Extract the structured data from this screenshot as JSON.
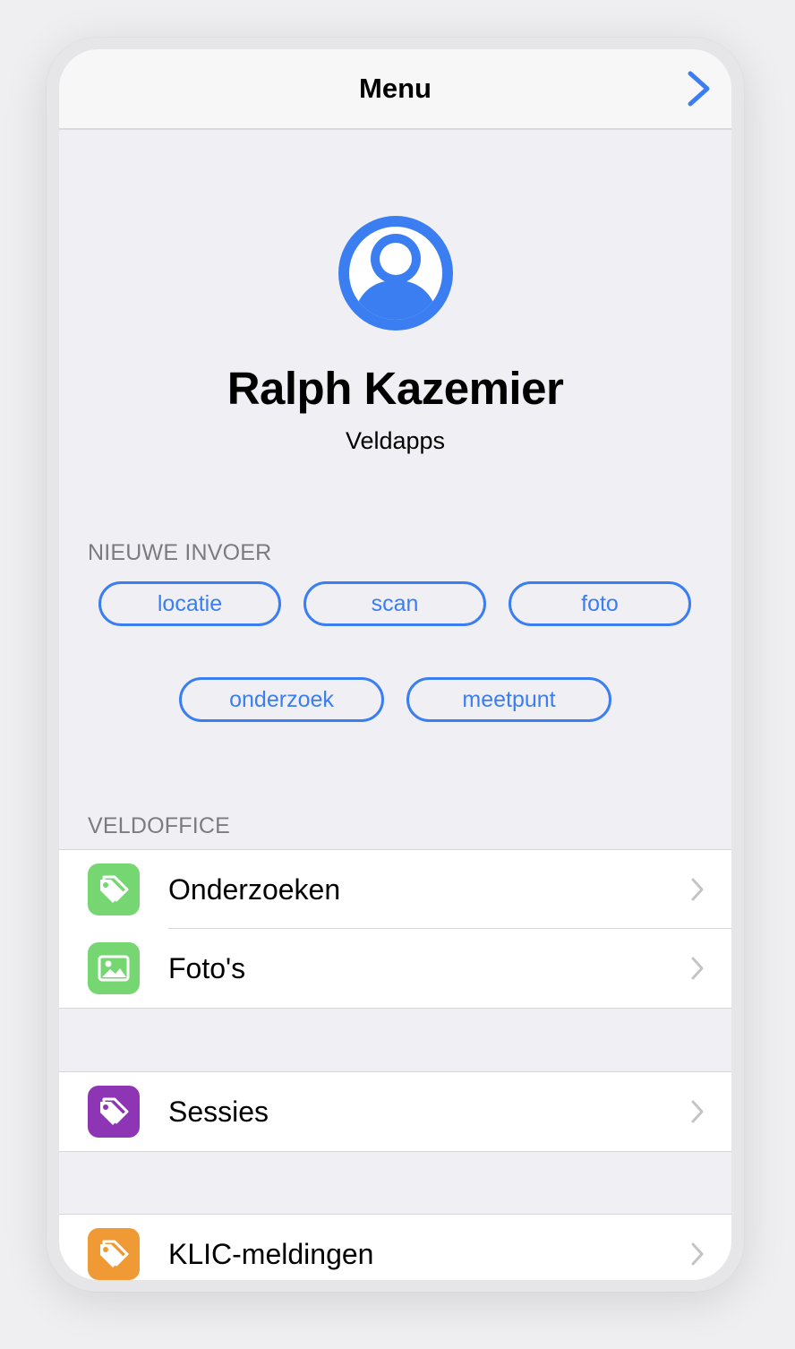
{
  "navbar": {
    "title": "Menu",
    "forward_icon": "chevron-right-icon"
  },
  "profile": {
    "avatar_icon": "person-circle-icon",
    "name": "Ralph Kazemier",
    "organization": "Veldapps"
  },
  "new_entry": {
    "header": "NIEUWE INVOER",
    "buttons": [
      {
        "label": "locatie"
      },
      {
        "label": "scan"
      },
      {
        "label": "foto"
      },
      {
        "label": "onderzoek"
      },
      {
        "label": "meetpunt"
      }
    ]
  },
  "veldoffice": {
    "header": "VELDOFFICE",
    "items": [
      {
        "label": "Onderzoeken",
        "icon": "tags-icon",
        "color": "#76d672"
      },
      {
        "label": "Foto's",
        "icon": "photo-icon",
        "color": "#76d672"
      }
    ]
  },
  "sessions": {
    "items": [
      {
        "label": "Sessies",
        "icon": "tags-icon",
        "color": "#8e35b5"
      }
    ]
  },
  "klic": {
    "items": [
      {
        "label": "KLIC-meldingen",
        "icon": "tags-icon",
        "color": "#f09a36"
      }
    ]
  },
  "colors": {
    "accent": "#3a7ef1",
    "chevron": "#c4c4c7"
  }
}
